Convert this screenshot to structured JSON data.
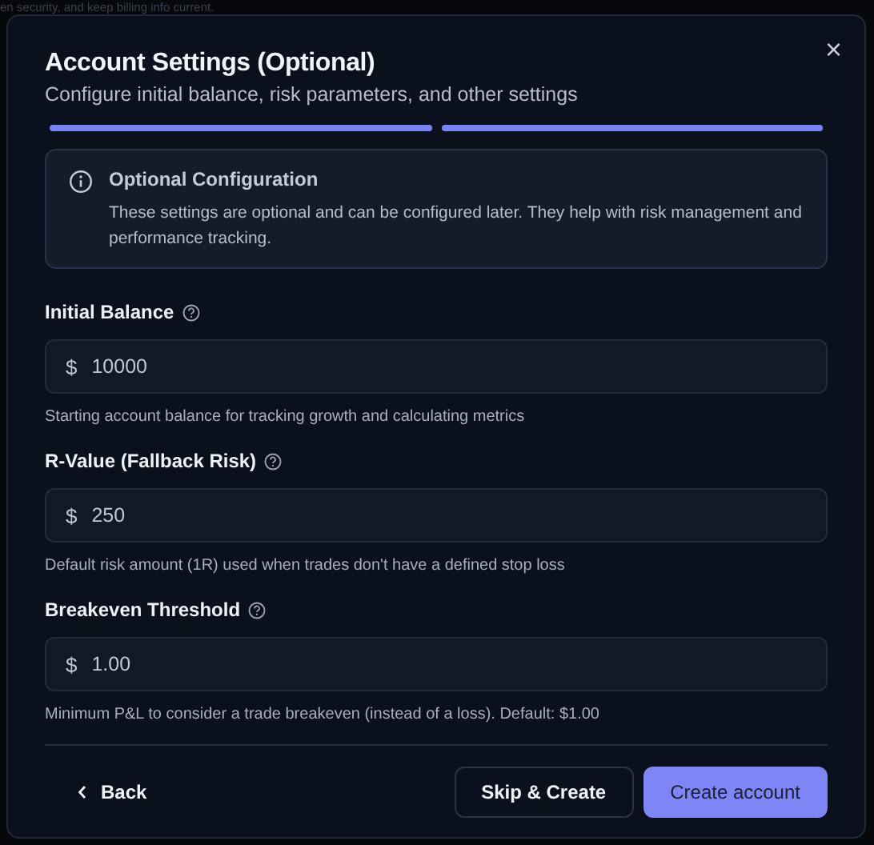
{
  "backdrop_text": "en security, and keep billing info current.",
  "dialog": {
    "title": "Account Settings (Optional)",
    "subtitle": "Configure initial balance, risk parameters, and other settings",
    "close": "×"
  },
  "steps": [
    {
      "complete": true
    },
    {
      "complete": true
    }
  ],
  "notice": {
    "title": "Optional Configuration",
    "text": "These settings are optional and can be configured later. They help with risk management and performance tracking."
  },
  "fields": [
    {
      "label": "Initial Balance",
      "prefix": "$",
      "value": "10000",
      "hint": "Starting account balance for tracking growth and calculating metrics"
    },
    {
      "label": "R-Value (Fallback Risk)",
      "prefix": "$",
      "value": "250",
      "hint": "Default risk amount (1R) used when trades don't have a defined stop loss"
    },
    {
      "label": "Breakeven Threshold",
      "prefix": "$",
      "value": "1.00",
      "hint": "Minimum P&L to consider a trade breakeven (instead of a loss). Default: $1.00"
    }
  ],
  "buttons": [
    {
      "kind": "back",
      "label": "Back"
    },
    {
      "kind": "outline",
      "label": "Skip & Create"
    },
    {
      "kind": "primary",
      "label": "Create account"
    }
  ]
}
